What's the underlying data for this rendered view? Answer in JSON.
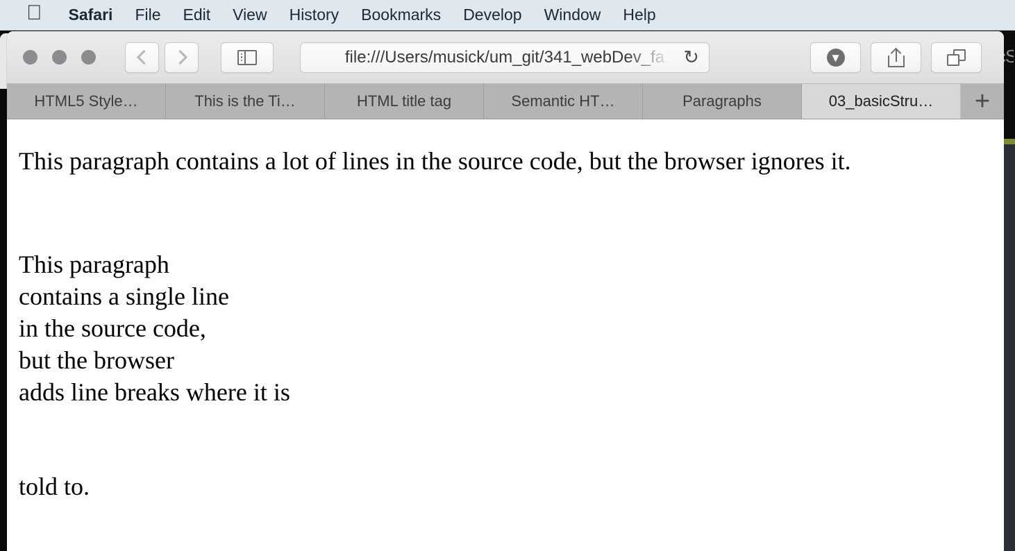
{
  "menubar": {
    "apple_icon": "apple-logo-icon",
    "items": [
      {
        "label": "Safari",
        "bold": true
      },
      {
        "label": "File"
      },
      {
        "label": "Edit"
      },
      {
        "label": "View"
      },
      {
        "label": "History"
      },
      {
        "label": "Bookmarks"
      },
      {
        "label": "Develop"
      },
      {
        "label": "Window"
      },
      {
        "label": "Help"
      }
    ]
  },
  "toolbar": {
    "back_icon": "chevron-left-icon",
    "forward_icon": "chevron-right-icon",
    "sidebar_icon": "sidebar-toggle-icon",
    "url": "file:///Users/musick/um_git/341_webDev_fa",
    "reload_icon": "↻",
    "downloads_icon": "⬇",
    "share_icon": "share-icon",
    "tab_overview_icon": "tab-overview-icon"
  },
  "tabs": {
    "items": [
      {
        "label": "HTML5 Style…",
        "active": false
      },
      {
        "label": "This is the Ti…",
        "active": false
      },
      {
        "label": "HTML title tag",
        "active": false
      },
      {
        "label": "Semantic HT…",
        "active": false
      },
      {
        "label": "Paragraphs",
        "active": false
      },
      {
        "label": "03_basicStru…",
        "active": true
      }
    ],
    "new_tab_label": "+"
  },
  "page": {
    "paragraph_1": "This paragraph contains a lot of lines in the source code, but the browser ignores it.",
    "paragraph_2_lines": [
      "This paragraph",
      "contains a single line",
      "in the source code,",
      "but the browser",
      "adds line breaks where it is"
    ],
    "paragraph_3": "told to."
  },
  "background": {
    "editor_text": "cS"
  },
  "colors": {
    "menubar_bg": "#dfe8ee",
    "toolbar_bg": "#e6e6e6",
    "tabbar_bg": "#b4b4b4",
    "tab_active_bg": "#d8d8d8",
    "page_bg": "#ffffff",
    "editor_accent": "#7d8f2e",
    "editor_bg": "#2b2e33"
  }
}
